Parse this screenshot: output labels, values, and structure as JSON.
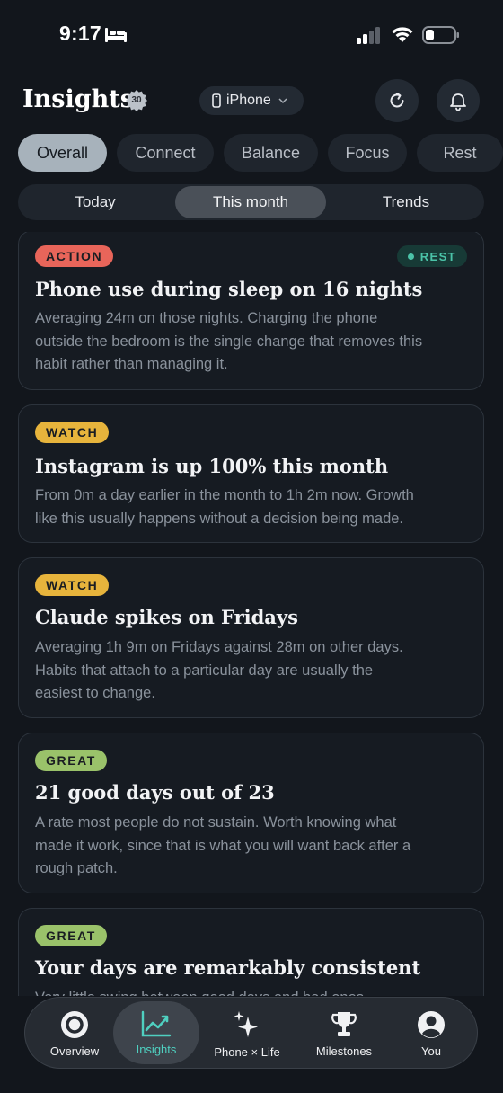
{
  "status_bar": {
    "time": "9:17"
  },
  "header": {
    "title": "Insights",
    "level_badge": "30",
    "device": "iPhone"
  },
  "category_tabs": [
    {
      "label": "Overall",
      "active": true
    },
    {
      "label": "Connect",
      "active": false
    },
    {
      "label": "Balance",
      "active": false
    },
    {
      "label": "Focus",
      "active": false
    },
    {
      "label": "Rest",
      "active": false
    }
  ],
  "period_tabs": [
    {
      "label": "Today",
      "active": false
    },
    {
      "label": "This month",
      "active": true
    },
    {
      "label": "Trends",
      "active": false
    }
  ],
  "cards": [
    {
      "badge": "ACTION",
      "tag": "REST",
      "title": "Phone use during sleep on 16 nights",
      "body_lines": [
        "Averaging 24m on those nights. Charging the phone",
        "outside the bedroom is the single change that removes this",
        "habit rather than managing it."
      ]
    },
    {
      "badge": "WATCH",
      "title": "Instagram is up 100% this month",
      "body_lines": [
        "From 0m a day earlier in the month to 1h 2m now. Growth",
        "like this usually happens without a decision being made."
      ]
    },
    {
      "badge": "WATCH",
      "title": "Claude spikes on Fridays",
      "body_lines": [
        "Averaging 1h 9m on Fridays against 28m on other days.",
        "Habits that attach to a particular day are usually the",
        "easiest to change."
      ]
    },
    {
      "badge": "GREAT",
      "title": "21 good days out of 23",
      "body_lines": [
        "A rate most people do not sustain. Worth knowing what",
        "made it work, since that is what you will want back after a",
        "rough patch."
      ]
    },
    {
      "badge": "GREAT",
      "title": "Your days are remarkably consistent",
      "body_lines": [
        "Very little swing between good days and bad ones."
      ]
    }
  ],
  "bottom_nav": [
    {
      "label": "Overview",
      "icon": "target-circle-icon",
      "active": false
    },
    {
      "label": "Insights",
      "icon": "chart-trend-icon",
      "active": true
    },
    {
      "label": "Phone × Life",
      "icon": "sparkles-icon",
      "active": false
    },
    {
      "label": "Milestones",
      "icon": "trophy-icon",
      "active": false
    },
    {
      "label": "You",
      "icon": "person-icon",
      "active": false
    }
  ],
  "colors": {
    "background": "#12161c",
    "action": "#e8655a",
    "watch": "#e7b43c",
    "great": "#9ac26a",
    "rest_tag": "#4bc3a8",
    "nav_active": "#4fd0c0"
  }
}
